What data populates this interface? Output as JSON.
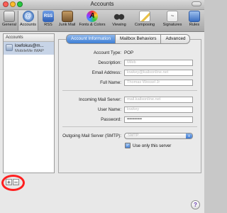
{
  "window": {
    "title": "Accounts"
  },
  "toolbar": {
    "items": [
      {
        "label": "General",
        "icon": "switch-icon"
      },
      {
        "label": "Accounts",
        "icon": "at-sign-icon"
      },
      {
        "label": "RSS",
        "icon": "rss-icon"
      },
      {
        "label": "Junk Mail",
        "icon": "junk-mail-icon"
      },
      {
        "label": "Fonts & Colors",
        "icon": "fonts-colors-icon"
      },
      {
        "label": "Viewing",
        "icon": "glasses-icon"
      },
      {
        "label": "Composing",
        "icon": "pencil-paper-icon"
      },
      {
        "label": "Signatures",
        "icon": "signature-icon"
      },
      {
        "label": "Rules",
        "icon": "rules-icon"
      }
    ],
    "selected": "Accounts"
  },
  "sidebar": {
    "header": "Accounts",
    "accounts": [
      {
        "name": "lowfokus@m...",
        "type": "MobileMe IMAP"
      }
    ]
  },
  "tabs": [
    {
      "label": "Account Information",
      "active": true
    },
    {
      "label": "Mailbox Behaviors",
      "active": false
    },
    {
      "label": "Advanced",
      "active": false
    }
  ],
  "form": {
    "account_type_label": "Account Type:",
    "account_type_value": "POP",
    "description_label": "Description:",
    "description_value": "iWeb",
    "email_label": "Email Address:",
    "email_value": "lowkey@kailsonline.net",
    "fullname_label": "Full Name:",
    "fullname_value": "Thomas Wessel Jr",
    "incoming_label": "Incoming Mail Server:",
    "incoming_value": "mail.kailsonline.net",
    "username_label": "User Name:",
    "username_value": "lowkey",
    "password_label": "Password:",
    "password_value": "••••••••••••",
    "outgoing_label": "Outgoing Mail Server (SMTP):",
    "outgoing_value": "SMTP",
    "only_server_label": "Use only this server",
    "only_server_checked": true
  },
  "bottom": {
    "add_label": "+",
    "remove_label": "–",
    "help_label": "?"
  },
  "colors": {
    "selected_tab": "#3d7fd6",
    "annotation_circle": "#ff1f1f",
    "account_selection": "#c7d4e7"
  }
}
